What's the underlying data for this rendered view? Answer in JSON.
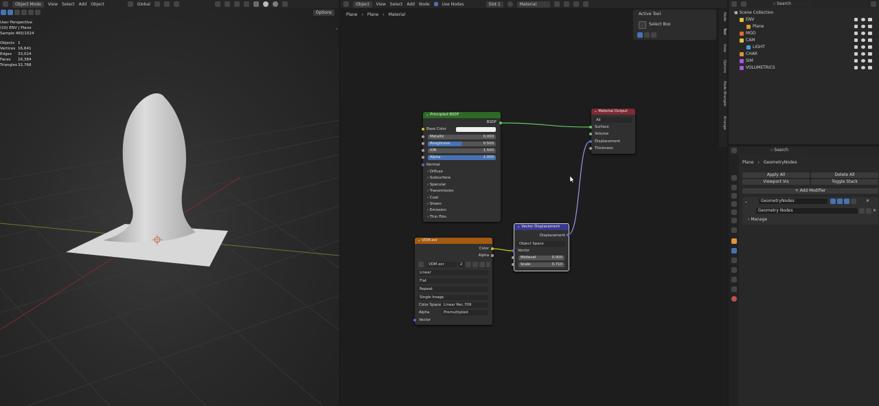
{
  "viewport": {
    "mode": "Object Mode",
    "menu": [
      "View",
      "Select",
      "Add",
      "Object"
    ],
    "orientation": "Global",
    "options_label": "Options",
    "stats": {
      "perspective": "User Perspective",
      "collection": "(10) ENV | Plane",
      "sample": "Sample 465/1024",
      "rows": [
        {
          "label": "Objects",
          "value": "1"
        },
        {
          "label": "Vertices",
          "value": "16,641"
        },
        {
          "label": "Edges",
          "value": "33,024"
        },
        {
          "label": "Faces",
          "value": "16,384"
        },
        {
          "label": "Triangles",
          "value": "32,768"
        }
      ]
    }
  },
  "node_editor": {
    "editor_type": "Object",
    "menu": [
      "View",
      "Select",
      "Add",
      "Node"
    ],
    "use_nodes_label": "Use Nodes",
    "slot": "Slot 1",
    "material": "Material",
    "breadcrumb": [
      "Plane",
      "Plane",
      "Material"
    ],
    "active_tool": {
      "title": "Active Tool",
      "tool": "Select Box"
    },
    "side_tabs": [
      "Node",
      "Tool",
      "View",
      "Options",
      "Node Wrangler",
      "Arrange"
    ],
    "principled": {
      "title": "Principled BSDF",
      "output": "BSDF",
      "base_color": "Base Color",
      "fields": [
        {
          "label": "Metallic",
          "value": "0.000",
          "fill": 0.0
        },
        {
          "label": "Roughness",
          "value": "0.500",
          "fill": 0.5
        },
        {
          "label": "IOR",
          "value": "1.500",
          "fill": 0.0
        },
        {
          "label": "Alpha",
          "value": "1.000",
          "fill": 1.0
        }
      ],
      "normal": "Normal",
      "panels": [
        "Diffuse",
        "Subsurface",
        "Specular",
        "Transmission",
        "Coat",
        "Sheen",
        "Emission",
        "Thin Film"
      ]
    },
    "material_output": {
      "title": "Material Output",
      "target": "All",
      "inputs": [
        "Surface",
        "Volume",
        "Displacement",
        "Thickness"
      ]
    },
    "vector_displacement": {
      "title": "Vector Displacement",
      "output": "Displacement",
      "space": "Object Space",
      "vector": "Vector",
      "fields": [
        {
          "label": "Midlevel",
          "value": "0.000"
        },
        {
          "label": "Scale",
          "value": "0.710"
        }
      ]
    },
    "image_node": {
      "title": "VDM.exr",
      "outputs": [
        "Color",
        "Alpha"
      ],
      "image_name": "VDM.exr",
      "users": "2",
      "dropdowns": [
        "Linear",
        "Flat",
        "Repeat",
        "Single Image"
      ],
      "color_space_label": "Color Space",
      "color_space": "Linear Rec.709",
      "alpha_label": "Alpha",
      "alpha_mode": "Premultiplied",
      "vector": "Vector"
    }
  },
  "outliner": {
    "search_placeholder": "Search",
    "root": "Scene Collection",
    "items": [
      {
        "name": "ENV",
        "color": "#e0c040"
      },
      {
        "name": "Plane",
        "color": "#e0933a"
      },
      {
        "name": "MOD",
        "color": "#e06a3a"
      },
      {
        "name": "CAM",
        "color": "#e0c040"
      },
      {
        "name": "LIGHT",
        "color": "#3aa3e0"
      },
      {
        "name": "CHAR",
        "color": "#e0933a"
      },
      {
        "name": "SIM",
        "color": "#a45ad8"
      },
      {
        "name": "VOLUMETRICS",
        "color": "#a45ad8"
      }
    ]
  },
  "properties": {
    "search_placeholder": "Search",
    "breadcrumb": [
      "Plane",
      "GeometryNodes"
    ],
    "buttons": [
      "Apply All",
      "Delete All",
      "Viewport Vis",
      "Toggle Stack"
    ],
    "add_modifier": "Add Modifier",
    "modifier_name": "GeometryNodes",
    "node_group": "Geometry Nodes",
    "manage": "Manage"
  },
  "colors": {
    "shader_header": "#2d6b24",
    "output_header": "#7d2a33",
    "vector_header": "#3a3a8f",
    "texture_header": "#a55a12",
    "accent": "#4772b3"
  }
}
